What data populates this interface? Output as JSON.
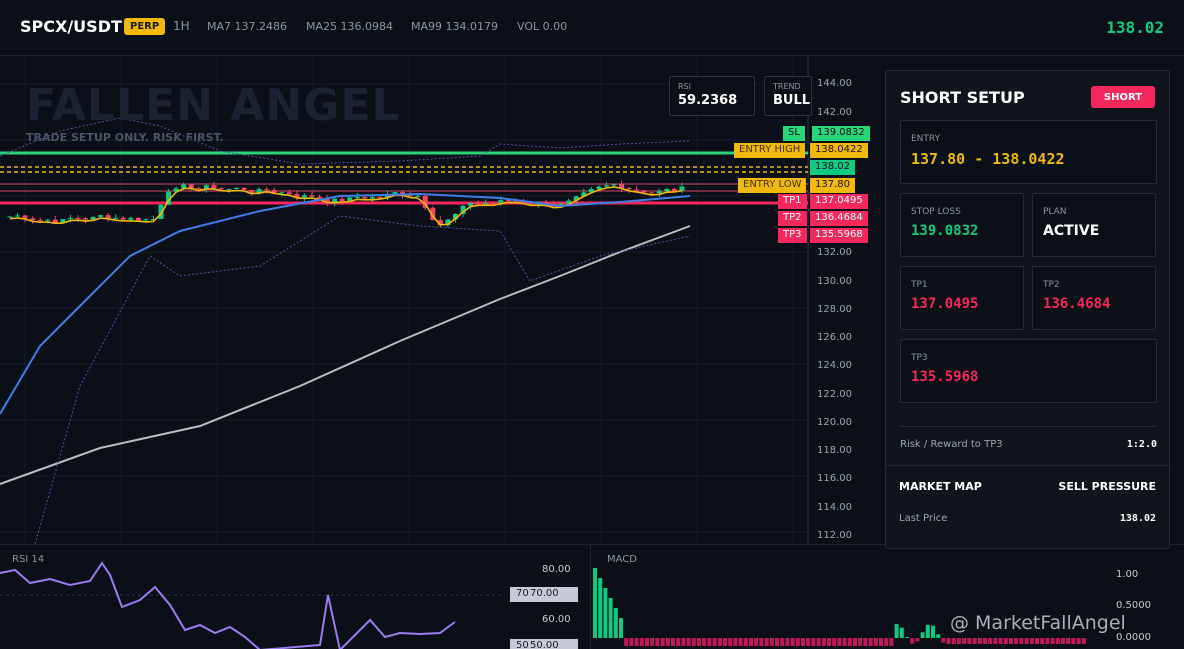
{
  "header": {
    "symbol": "SPCX/USDT",
    "badge": "PERP",
    "timeframe": "1H",
    "ma7": "MA7 137.2486",
    "ma25": "MA25 136.0984",
    "ma99": "MA99 134.0179",
    "vol": "VOL 0.00",
    "last_price": "138.02"
  },
  "chart": {
    "watermark_title": "FALLEN ANGEL",
    "watermark_sub": "TRADE SETUP ONLY. RISK FIRST.",
    "rsi_box": {
      "label": "RSI",
      "value": "59.2368"
    },
    "trend_box": {
      "label": "TREND",
      "value": "BULL"
    },
    "y_labels": [
      "144.00",
      "142.00",
      "132.00",
      "130.00",
      "128.00",
      "126.00",
      "124.00",
      "122.00",
      "120.00",
      "118.00",
      "116.00",
      "114.00",
      "112.00"
    ],
    "tags": {
      "sl": "SL",
      "sl_val": "139.0832",
      "entry_high": "ENTRY HIGH",
      "entry_high_val": "138.0422",
      "last": "138.02",
      "entry_low": "ENTRY LOW",
      "entry_low_val": "137.80",
      "tp1": "TP1",
      "tp1_val": "137.0495",
      "tp2": "TP2",
      "tp2_val": "136.4684",
      "tp3": "TP3",
      "tp3_val": "135.5968"
    },
    "colors": {
      "up": "#0ecb81",
      "down": "#f6465d",
      "ma7": "#f0b90b",
      "ma25": "#3d7ee8",
      "ma99": "#b8bcc6",
      "sl": "#29d67a",
      "entry": "#f0b90b",
      "tp": "#f6275c"
    }
  },
  "rsi": {
    "title": "RSI 14",
    "levels": [
      "80.00",
      "70.00",
      "60.00",
      "50.00"
    ],
    "tag70": "70",
    "tag50": "50"
  },
  "macd": {
    "title": "MACD",
    "levels": [
      "1.00",
      "0.5000",
      "0.0000"
    ]
  },
  "setup": {
    "title": "SHORT SETUP",
    "badge": "SHORT",
    "entry_label": "ENTRY",
    "entry_value": "137.80 - 138.0422",
    "stop_label": "STOP LOSS",
    "stop_value": "139.0832",
    "plan_label": "PLAN",
    "plan_value": "ACTIVE",
    "tp1_label": "TP1",
    "tp1_value": "137.0495",
    "tp2_label": "TP2",
    "tp2_value": "136.4684",
    "tp3_label": "TP3",
    "tp3_value": "135.5968",
    "rr_label": "Risk / Reward to TP3",
    "rr_value": "1:2.0"
  },
  "market": {
    "title": "MARKET MAP",
    "pressure": "SELL PRESSURE",
    "last_label": "Last Price",
    "last_value": "138.02"
  },
  "brand": "@ MarketFallAngel"
}
